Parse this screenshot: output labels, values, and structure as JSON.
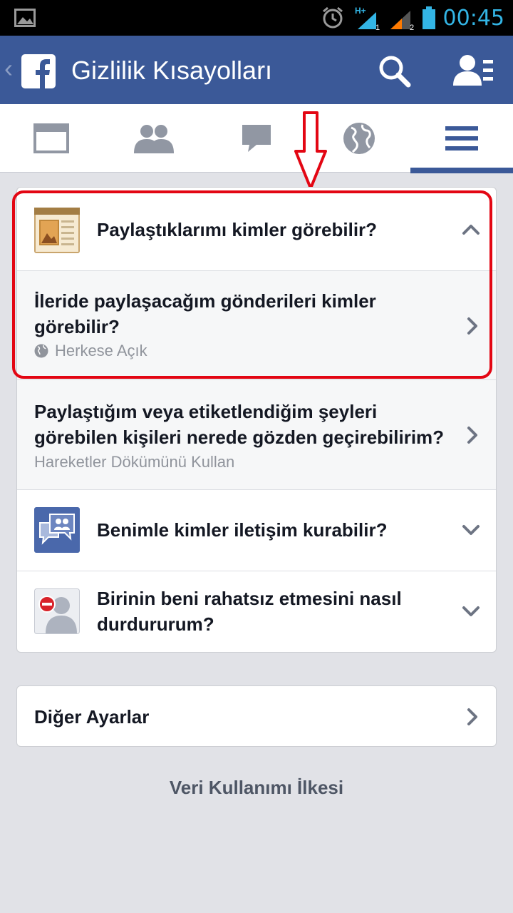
{
  "status_bar": {
    "time": "00:45",
    "network_label_1": "H+",
    "sim1_label": "1",
    "sim2_label": "2",
    "icons": [
      "gallery-icon",
      "alarm-icon",
      "signal-icon",
      "battery-icon"
    ],
    "accent_color": "#33b5e5"
  },
  "header": {
    "title": "Gizlilik Kısayolları",
    "background_color": "#3b5998",
    "icons": [
      "back-chevron-icon",
      "facebook-logo",
      "search-icon",
      "friend-requests-icon"
    ]
  },
  "tabs": [
    {
      "name": "news-feed",
      "icon": "news-feed-icon",
      "active": false
    },
    {
      "name": "friend-requests",
      "icon": "friends-icon",
      "active": false
    },
    {
      "name": "messages",
      "icon": "messages-icon",
      "active": false
    },
    {
      "name": "notifications",
      "icon": "globe-icon",
      "active": false
    },
    {
      "name": "more",
      "icon": "menu-icon",
      "active": true
    }
  ],
  "sections": {
    "who_can_see": {
      "title": "Paylaştıklarımı kimler görebilir?",
      "icon": "wall-post-icon",
      "expanded": true,
      "future_posts_title_line1": "İleride paylaşacağım gönderileri kimler",
      "future_posts_title_line2": "görebilir?",
      "future_posts_value": "Herkese Açık",
      "activity_log_title_line1": "Paylaştığım veya etiketlendiğim şeyleri",
      "activity_log_title_line2": "görebilen kişileri nerede gözden geçirebilirim?",
      "activity_log_subtitle": "Hareketler Dökümünü Kullan"
    },
    "who_can_contact": {
      "title": "Benimle kimler iletişim kurabilir?",
      "icon": "contact-messages-icon"
    },
    "block": {
      "title_line1": "Birinin beni rahatsız etmesini nasıl",
      "title_line2": "durdururum?",
      "icon": "block-user-icon"
    }
  },
  "other_settings": {
    "label": "Diğer Ayarlar"
  },
  "footer": {
    "data_policy_link": "Veri Kullanımı İlkesi"
  },
  "annotation": {
    "color": "#e30613"
  }
}
